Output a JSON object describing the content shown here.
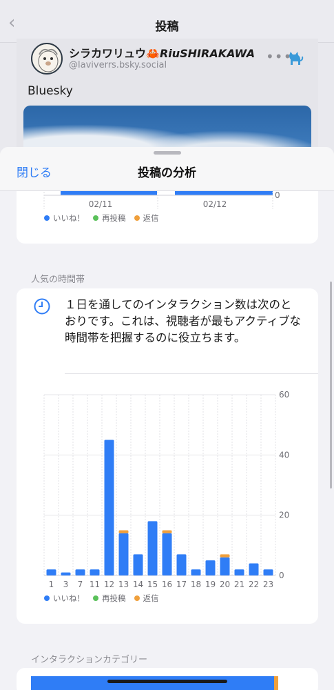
{
  "post_page": {
    "title": "投稿",
    "author": {
      "name_ja": "シラカワリュウ",
      "name_emoji": "🦀",
      "name_latin": "RiuSHIRAKAWA",
      "handle": "@laviverrs.bsky.social"
    },
    "post_text": "Bluesky"
  },
  "sheet": {
    "close_label": "閉じる",
    "title": "投稿の分析"
  },
  "daily_chart": {
    "dates": [
      "02/11",
      "02/12"
    ],
    "y_tick": "0",
    "legend": {
      "likes": "いいね！",
      "reposts": "再投稿",
      "replies": "返信"
    }
  },
  "popular_hours": {
    "section_label": "人気の時間帯",
    "info_text": "１日を通してのインタラクション数は次のとおりです。これは、視聴者が最もアクティブな時間帯を把握するのに役立ちます。",
    "legend": {
      "likes": "いいね！",
      "reposts": "再投稿",
      "replies": "返信"
    }
  },
  "categories": {
    "section_label": "インタラクションカテゴリー"
  },
  "colors": {
    "likes": "#2f7df6",
    "reposts": "#5ac15a",
    "replies": "#f0a03c",
    "accent": "#2f7df6"
  },
  "chart_data": {
    "type": "bar",
    "stacked": true,
    "categories": [
      "1",
      "3",
      "7",
      "11",
      "12",
      "13",
      "14",
      "15",
      "16",
      "17",
      "18",
      "19",
      "20",
      "21",
      "22",
      "23"
    ],
    "series": [
      {
        "name": "いいね！",
        "values": [
          2,
          1,
          2,
          2,
          45,
          14,
          7,
          18,
          14,
          7,
          2,
          5,
          6,
          2,
          4,
          2
        ]
      },
      {
        "name": "再投稿",
        "values": [
          0,
          0,
          0,
          0,
          0,
          0,
          0,
          0,
          0,
          0,
          0,
          0,
          0,
          0,
          0,
          0
        ]
      },
      {
        "name": "返信",
        "values": [
          0,
          0,
          0,
          0,
          0,
          1,
          0,
          0,
          1,
          0,
          0,
          0,
          1,
          0,
          0,
          0
        ]
      }
    ],
    "yticks": [
      "0",
      "20",
      "40",
      "60"
    ],
    "ylim": [
      0,
      60
    ],
    "y_axis_side": "right",
    "grid": true,
    "legend_position": "bottom-left"
  }
}
